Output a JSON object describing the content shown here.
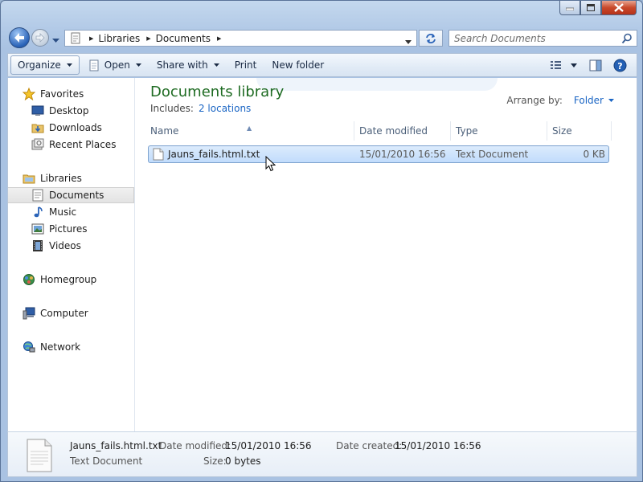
{
  "address": {
    "crumbs": [
      "Libraries",
      "Documents"
    ]
  },
  "search": {
    "placeholder": "Search Documents"
  },
  "toolbar": {
    "organize": "Organize",
    "open": "Open",
    "share_with": "Share with",
    "print": "Print",
    "new_folder": "New folder"
  },
  "nav": {
    "favorites": "Favorites",
    "desktop": "Desktop",
    "downloads": "Downloads",
    "recent_places": "Recent Places",
    "libraries": "Libraries",
    "documents": "Documents",
    "music": "Music",
    "pictures": "Pictures",
    "videos": "Videos",
    "homegroup": "Homegroup",
    "computer": "Computer",
    "network": "Network"
  },
  "library": {
    "title": "Documents library",
    "includes_label": "Includes:",
    "includes_link": "2 locations",
    "arrange_label": "Arrange by:",
    "arrange_value": "Folder"
  },
  "columns": [
    "Name",
    "Date modified",
    "Type",
    "Size"
  ],
  "files": [
    {
      "name": "Jauns_fails.html.txt",
      "date_modified": "15/01/2010 16:56",
      "type": "Text Document",
      "size": "0 KB"
    }
  ],
  "details": {
    "filename": "Jauns_fails.html.txt",
    "filetype": "Text Document",
    "date_modified_label": "Date modified:",
    "date_modified": "15/01/2010 16:56",
    "date_created_label": "Date created:",
    "date_created": "15/01/2010 16:56",
    "size_label": "Size:",
    "size": "0 bytes"
  },
  "colors": {
    "library_title": "#1e6b22",
    "link": "#1a65c4",
    "selection": "#c1dcfc"
  },
  "icons": [
    "back-icon",
    "forward-icon",
    "folder-icon",
    "refresh-icon",
    "search-icon",
    "open-icon",
    "views-icon",
    "preview-pane-icon",
    "help-icon",
    "star-icon",
    "desktop-icon",
    "downloads-icon",
    "recent-places-icon",
    "libraries-icon",
    "documents-icon",
    "music-icon",
    "pictures-icon",
    "videos-icon",
    "homegroup-icon",
    "computer-icon",
    "network-icon",
    "text-file-icon",
    "mouse-cursor-icon"
  ]
}
